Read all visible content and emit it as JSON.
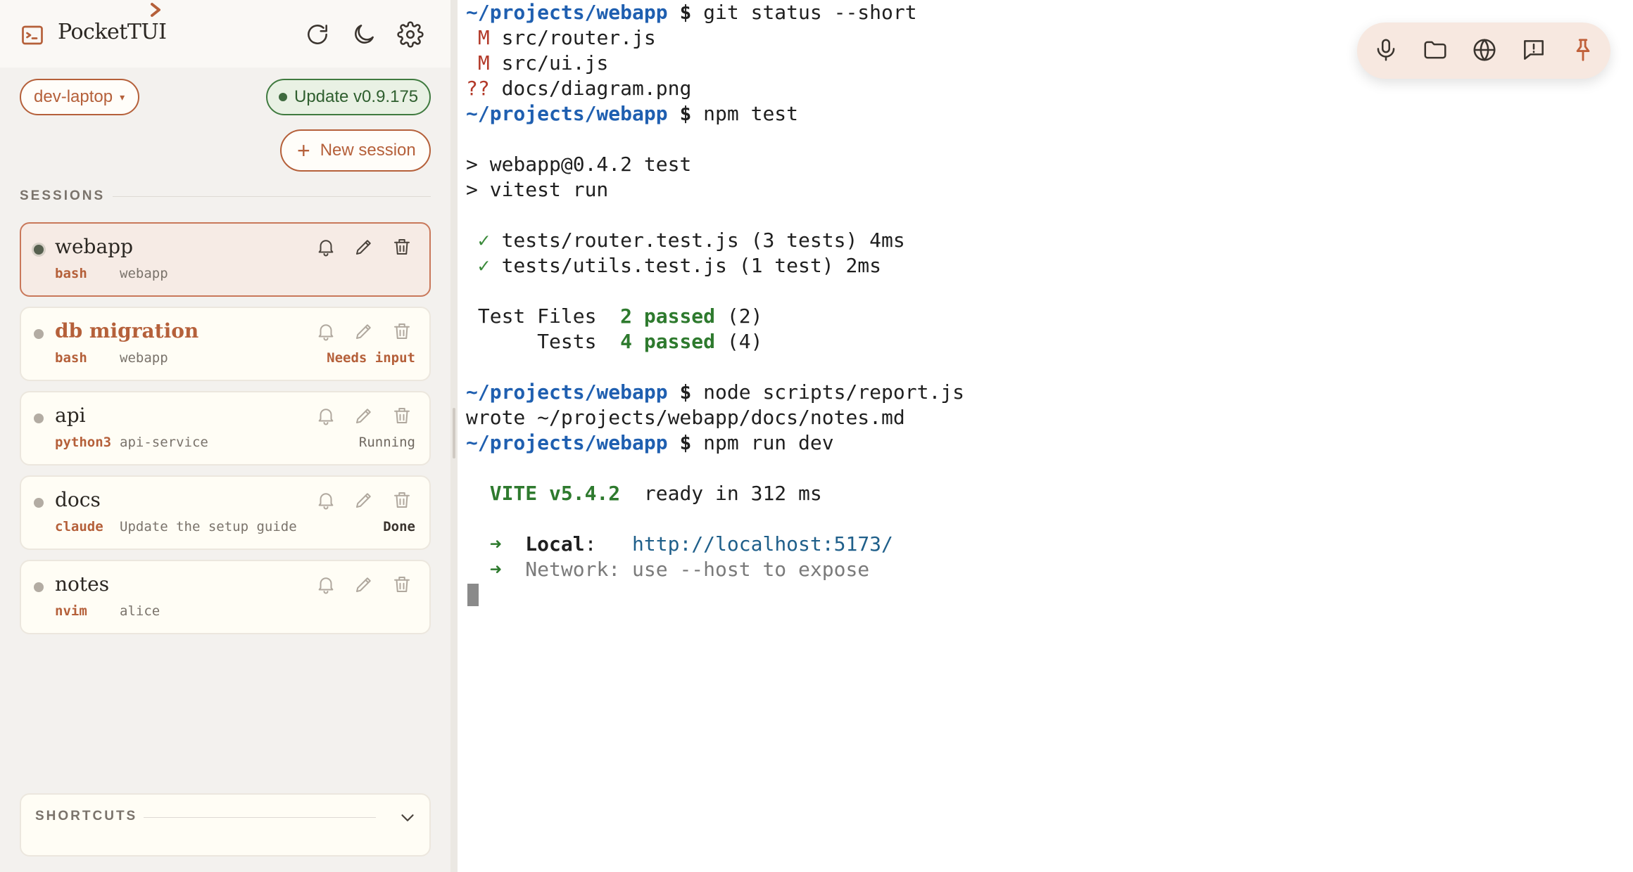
{
  "app": {
    "title": "PocketTUI",
    "icon": "terminal-square-icon"
  },
  "header": {
    "actions": [
      {
        "name": "refresh",
        "icon": "refresh-icon"
      },
      {
        "name": "theme",
        "icon": "moon-icon"
      },
      {
        "name": "settings",
        "icon": "gear-icon"
      }
    ]
  },
  "host": {
    "selected": "dev-laptop",
    "caret": "▾"
  },
  "update": {
    "label": "Update v0.9.175",
    "color": "#3f7a3f"
  },
  "new_session": {
    "label": "New session",
    "icon": "+"
  },
  "sessions": {
    "heading": "SESSIONS",
    "items": [
      {
        "name": "webapp",
        "command": "bash",
        "cwd": "webapp",
        "state": "",
        "active": true
      },
      {
        "name": "db migration",
        "command": "bash",
        "cwd": "webapp",
        "state": "Needs input",
        "active": false
      },
      {
        "name": "api",
        "command": "python3",
        "cwd": "api-service",
        "state": "Running",
        "active": false
      },
      {
        "name": "docs",
        "command": "claude",
        "cwd": "Update the setup guide",
        "state": "Done",
        "active": false
      },
      {
        "name": "notes",
        "command": "nvim",
        "cwd": "alice",
        "state": "",
        "active": false
      }
    ]
  },
  "shortcuts": {
    "heading": "SHORTCUTS"
  },
  "terminal": {
    "prompt": "~/projects/webapp",
    "dollar": "$",
    "cmd1": "git status --short",
    "git_lines": [
      {
        "flag": " M",
        "path": "src/router.js"
      },
      {
        "flag": " M",
        "path": "src/ui.js"
      },
      {
        "flag": "??",
        "path": "docs/diagram.png"
      }
    ],
    "cmd2": "npm test",
    "npm_header1": "> webapp@0.4.2 test",
    "npm_header2": "> vitest run",
    "tests": [
      {
        "check": "✓",
        "text": "tests/router.test.js (3 tests) 4ms"
      },
      {
        "check": "✓",
        "text": "tests/utils.test.js (1 test) 2ms"
      }
    ],
    "summary_files_label": " Test Files  ",
    "summary_files_passed": "2 passed",
    "summary_files_total": " (2)",
    "summary_tests_label": "      Tests  ",
    "summary_tests_passed": "4 passed",
    "summary_tests_total": " (4)",
    "cmd3": "node scripts/report.js",
    "report_output": "wrote ~/projects/webapp/docs/notes.md",
    "cmd4": "npm run dev",
    "vite_name": "VITE v5.4.2",
    "vite_ready": "  ready in 312 ms",
    "arrow": "➜",
    "local_label": "Local",
    "local_sep": ":   ",
    "local_url": "http://localhost:5173/",
    "network_text": "Network: use --host to expose"
  },
  "toolbar": {
    "buttons": [
      {
        "name": "microphone",
        "icon": "microphone-icon"
      },
      {
        "name": "files",
        "icon": "folder-icon"
      },
      {
        "name": "browser",
        "icon": "globe-icon"
      },
      {
        "name": "feedback",
        "icon": "feedback-icon"
      },
      {
        "name": "pin",
        "icon": "pin-icon"
      }
    ]
  },
  "colors": {
    "accent": "#b5603a",
    "prompt": "#1f5fb0",
    "success": "#2e7a2e",
    "sidebar_bg": "#f3f1ee"
  }
}
